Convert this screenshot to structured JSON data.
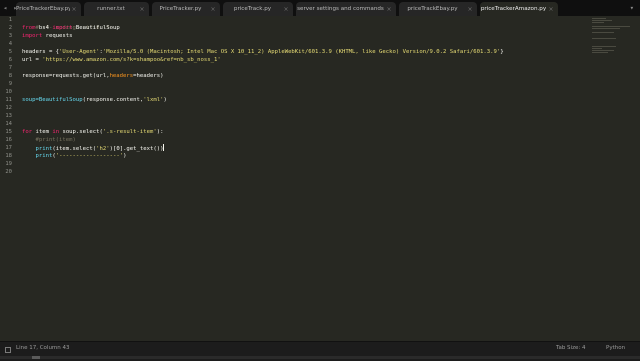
{
  "tabs": [
    {
      "label": "PriceTrackerEbay.py",
      "active": false
    },
    {
      "label": "runner.txt",
      "active": false
    },
    {
      "label": "PriceTracker.py",
      "active": false
    },
    {
      "label": "priceTrack.py",
      "active": false
    },
    {
      "label": "server settings and commands",
      "active": false
    },
    {
      "label": "priceTrackEbay.py",
      "active": false
    },
    {
      "label": "priceTrackerAmazon.py",
      "active": true
    }
  ],
  "close_glyph": "×",
  "nav_arrows": "◂ ▸",
  "overflow_glyph": "▾",
  "line_numbers": [
    "1",
    "2",
    "3",
    "4",
    "5",
    "6",
    "7",
    "8",
    "9",
    "10",
    "11",
    "12",
    "13",
    "14",
    "15",
    "16",
    "17",
    "18",
    "19",
    "20"
  ],
  "code": {
    "l1": "# -*- coding: utf-8 -*-",
    "l2_kw1": "from",
    "l2_mod": " bs4 ",
    "l2_kw2": "import",
    "l2_name": " BeautifulSoup",
    "l3_kw": "import",
    "l3_name": " requests",
    "l5_a": "headers = {",
    "l5_str1": "'User-Agent'",
    "l5_colon": ":",
    "l5_str2": "'Mozilla/5.0 (Macintosh; Intel Mac OS X 10_11_2) AppleWebKit/601.3.9 (KHTML, like Gecko) Version/9.0.2 Safari/601.3.9'",
    "l5_end": "}",
    "l6_a": "url = ",
    "l6_str": "'https://www.amazon.com/s?k=shampoo&ref=nb_sb_noss_1'",
    "l8_a": "response=requests.get(url,",
    "l8_param": "headers",
    "l8_b": "=headers)",
    "l11_fn": "soup=BeautifulSoup",
    "l11_a": "(response.content,",
    "l11_str": "'lxml'",
    "l11_b": ")",
    "l15_kw1": "for",
    "l15_a": " item ",
    "l15_kw2": "in",
    "l15_b": " soup.select(",
    "l15_str": "'.s-result-item'",
    "l15_c": "):",
    "l16": "    #print(item)",
    "l17_indent": "    ",
    "l17_fn": "print",
    "l17_a": "(item.select(",
    "l17_str": "'h2'",
    "l17_b": ")[0].get_text())",
    "l18_indent": "    ",
    "l18_fn": "print",
    "l18_a": "(",
    "l18_str": "'------------------'",
    "l18_b": ")"
  },
  "status": {
    "position": "Line 17, Column 43",
    "tab_size": "Tab Size: 4",
    "syntax": "Python"
  }
}
